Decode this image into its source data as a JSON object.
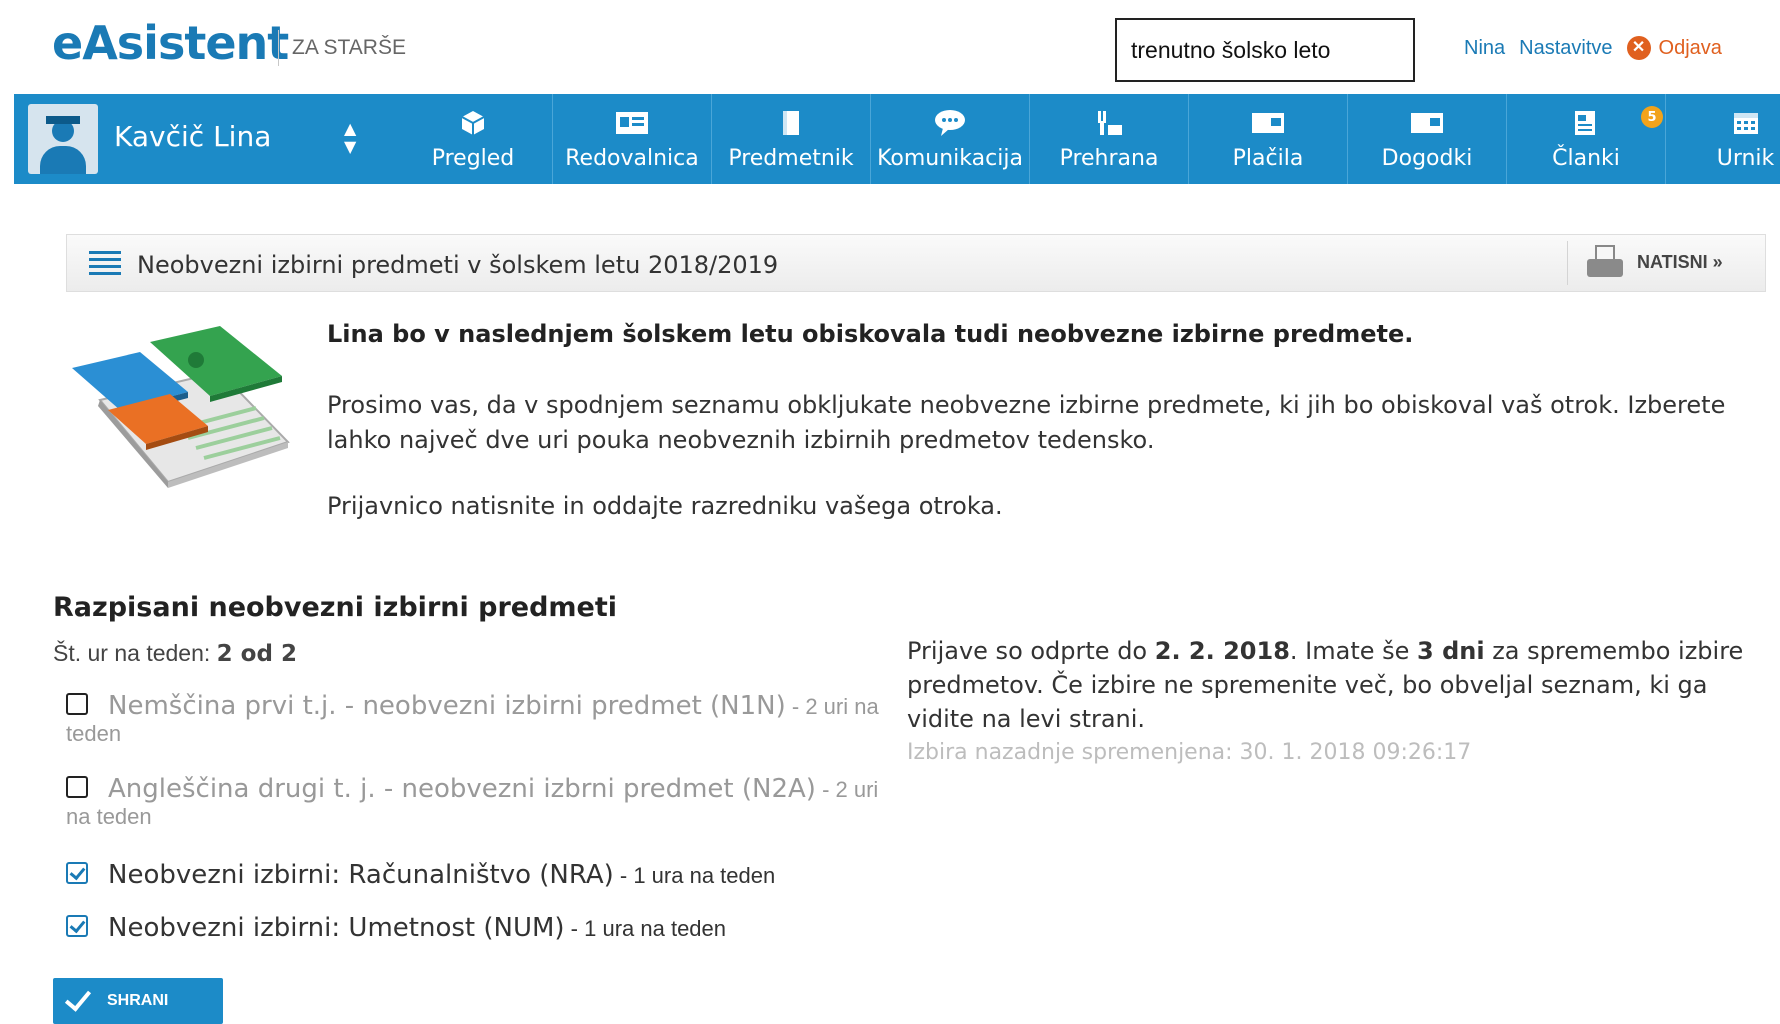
{
  "header": {
    "logo": "eAsistent",
    "logo_sub": "ZA STARŠE",
    "school_year": "trenutno šolsko leto",
    "user_link": "Nina",
    "settings_link": "Nastavitve",
    "logout_link": "Odjava",
    "logout_icon": "close-circle-icon"
  },
  "child_selector": {
    "name": "Kavčič Lina",
    "toggle_icon": "sort-arrows-icon"
  },
  "nav": {
    "items": [
      {
        "label": "Pregled",
        "icon": "cube-icon"
      },
      {
        "label": "Redovalnica",
        "icon": "id-card-icon"
      },
      {
        "label": "Predmetnik",
        "icon": "book-icon"
      },
      {
        "label": "Komunikacija",
        "icon": "chat-bubble-icon"
      },
      {
        "label": "Prehrana",
        "icon": "food-icon"
      },
      {
        "label": "Plačila",
        "icon": "payment-icon"
      },
      {
        "label": "Dogodki",
        "icon": "event-icon"
      },
      {
        "label": "Članki",
        "icon": "article-icon",
        "badge": "5"
      },
      {
        "label": "Urnik",
        "icon": "calendar-icon"
      }
    ]
  },
  "section": {
    "title": "Neobvezni izbirni predmeti v šolskem letu 2018/2019",
    "print_label": "NATISNI »"
  },
  "intro": {
    "title": "Lina bo v naslednjem šolskem letu obiskovala tudi neobvezne izbirne predmete.",
    "paragraph1": "Prosimo vas, da v spodnjem seznamu obkljukate neobvezne izbirne predmete, ki jih bo obiskoval vaš otrok. Izberete lahko največ dve uri pouka neobveznih izbirnih predmetov tedensko.",
    "paragraph2": "Prijavnico natisnite in oddajte razredniku vašega otroka."
  },
  "subjects": {
    "title": "Razpisani neobvezni izbirni predmeti",
    "hours_label": "Št. ur na teden: ",
    "hours_value": "2 od 2",
    "items": [
      {
        "name": "Nemščina prvi t.j. - neobvezni izbirni predmet (N1N)",
        "hours": " - 2 uri na teden",
        "checked": false
      },
      {
        "name": "Angleščina drugi t. j. - neobvezni izbrni predmet (N2A)",
        "hours": " - 2 uri na teden",
        "checked": false
      },
      {
        "name": "Neobvezni izbirni: Računalništvo (NRA)",
        "hours": " - 1 ura na teden",
        "checked": true
      },
      {
        "name": "Neobvezni izbirni: Umetnost (NUM)",
        "hours": " - 1 ura na teden",
        "checked": true
      }
    ],
    "save_label": "SHRANI"
  },
  "info": {
    "t1": "Prijave so odprte do ",
    "deadline": "2. 2. 2018",
    "t2": ". Imate še ",
    "days": "3 dni",
    "t3": " za spremembo izbire predmetov. Če izbire ne spremenite več, bo obveljal seznam, ki ga vidite na levi strani.",
    "last_modified": "Izbira nazadnje spremenjena: 30. 1. 2018 09:26:17"
  },
  "colors": {
    "brand_blue": "#1c8bc8",
    "logout_orange": "#e0601f",
    "badge_orange": "#f2a31b"
  }
}
